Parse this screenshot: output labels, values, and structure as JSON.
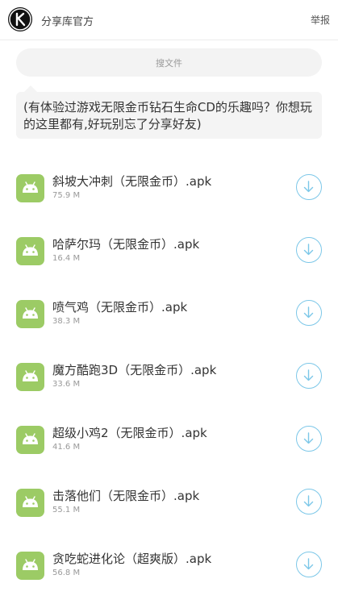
{
  "header": {
    "site_name": "分享库官方",
    "report_label": "举报"
  },
  "search": {
    "placeholder": "搜文件"
  },
  "message": {
    "text": "(有体验过游戏无限金币钻石生命CD的乐趣吗？你想玩的这里都有,好玩别忘了分享好友)"
  },
  "files": [
    {
      "name": "斜坡大冲刺（无限金币）.apk",
      "size": "75.9 M"
    },
    {
      "name": "哈萨尔玛（无限金币）.apk",
      "size": "16.4 M"
    },
    {
      "name": "喷气鸡（无限金币）.apk",
      "size": "38.3 M"
    },
    {
      "name": "魔方酷跑3D（无限金币）.apk",
      "size": "33.6 M"
    },
    {
      "name": "超级小鸡2（无限金币）.apk",
      "size": "41.6 M"
    },
    {
      "name": "击落他们（无限金币）.apk",
      "size": "55.1 M"
    },
    {
      "name": "贪吃蛇进化论（超爽版）.apk",
      "size": "56.8 M"
    }
  ],
  "colors": {
    "android_icon_bg": "#9ccb65",
    "download_accent": "#7cc7e8"
  },
  "icons": {
    "logo": "k-logo-icon",
    "file": "android-icon",
    "download": "download-arrow-icon"
  }
}
